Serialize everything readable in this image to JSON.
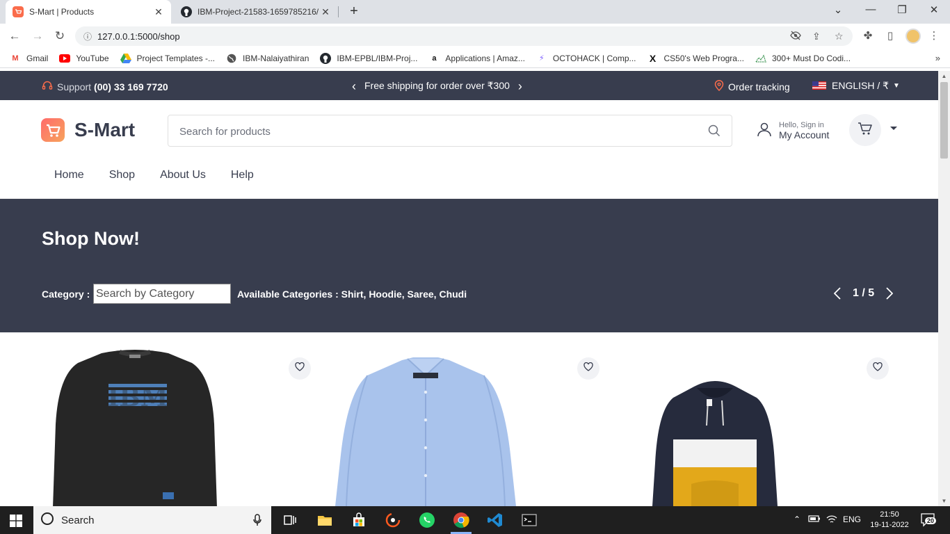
{
  "browser": {
    "tabs": [
      {
        "title": "S-Mart | Products",
        "active": true
      },
      {
        "title": "IBM-Project-21583-1659785216/",
        "active": false
      }
    ],
    "new_tab": "+",
    "url": "127.0.0.1:5000/shop",
    "bookmarks": [
      {
        "label": "Gmail",
        "icon": "gmail-icon"
      },
      {
        "label": "YouTube",
        "icon": "youtube-icon"
      },
      {
        "label": "Project Templates -...",
        "icon": "drive-icon"
      },
      {
        "label": "IBM-Nalaiyathiran",
        "icon": "globe-icon"
      },
      {
        "label": "IBM-EPBL/IBM-Proj...",
        "icon": "github-icon"
      },
      {
        "label": "Applications | Amaz...",
        "icon": "amazon-icon"
      },
      {
        "label": "OCTOHACK | Comp...",
        "icon": "octohack-icon"
      },
      {
        "label": "CS50's Web Progra...",
        "icon": "edx-icon"
      },
      {
        "label": "300+ Must Do Codi...",
        "icon": "chart-icon"
      }
    ],
    "bookmarks_more": "»"
  },
  "topbar": {
    "support_label": "Support",
    "support_phone": "(00) 33 169 7720",
    "shipping": "Free shipping for order over ₹300",
    "order_tracking": "Order tracking",
    "language": "ENGLISH / ₹"
  },
  "header": {
    "brand": "S-Mart",
    "search_placeholder": "Search for products",
    "account_greeting": "Hello, Sign in",
    "account_label": "My Account"
  },
  "menu": [
    "Home",
    "Shop",
    "About Us",
    "Help"
  ],
  "banner": {
    "title": "Shop Now!",
    "category_label": "Category :",
    "category_placeholder": "Search by Category",
    "available_categories": "Available Categories : Shirt, Hoodie, Saree, Chudi",
    "pager": "1 / 5"
  },
  "products": [
    {
      "name": "IBM Sweatshirt",
      "image": "black-ibm-sweatshirt",
      "print": "IBM"
    },
    {
      "name": "Blue Shirt",
      "image": "light-blue-shirt"
    },
    {
      "name": "Hoodie",
      "image": "navy-white-yellow-hoodie"
    }
  ],
  "colors": {
    "dark": "#383d4e",
    "accent": "#fa6c4b",
    "muted": "#6b6f7a"
  },
  "taskbar": {
    "search": "Search",
    "lang": "ENG",
    "time": "21:50",
    "date": "19-11-2022",
    "notifications": "20"
  }
}
